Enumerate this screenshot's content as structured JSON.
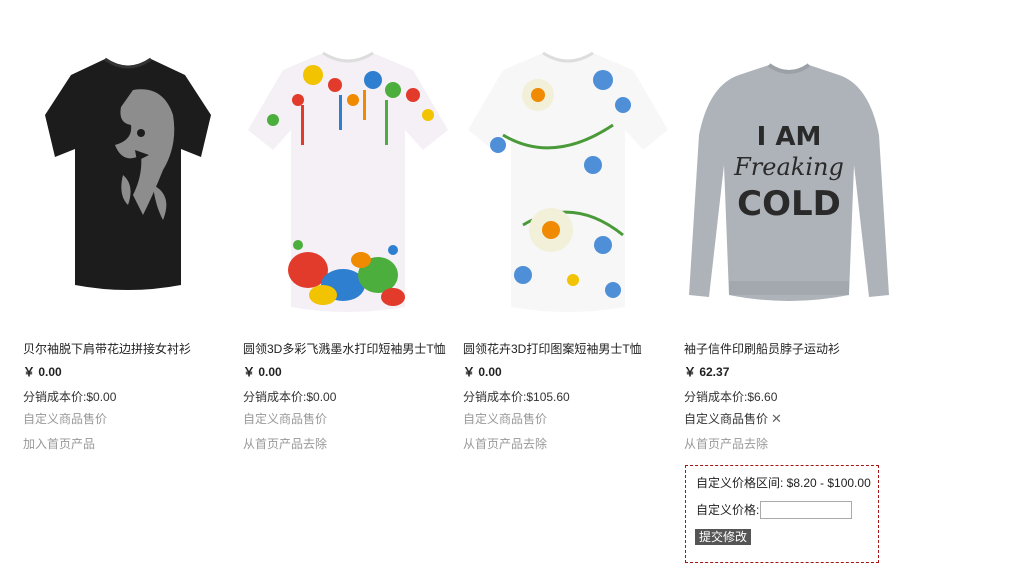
{
  "products": [
    {
      "name": "贝尔袖脱下肩带花边拼接女衬衫",
      "price": "￥ 0.00",
      "cost_label": "分销成本价:",
      "cost": "$0.00",
      "link1": "自定义商品售价",
      "link2": "加入首页产品",
      "image_icon": "black-tshirt-lion-print"
    },
    {
      "name": "圆领3D多彩飞溅墨水打印短袖男士T恤",
      "price": "￥ 0.00",
      "cost_label": "分销成本价:",
      "cost": "$0.00",
      "link1": "自定义商品售价",
      "link2": "从首页产品去除",
      "image_icon": "white-tshirt-paint-splash"
    },
    {
      "name": "圆领花卉3D打印图案短袖男士T恤",
      "price": "￥ 0.00",
      "cost_label": "分销成本价:",
      "cost": "$105.60",
      "link1": "自定义商品售价",
      "link2": "从首页产品去除",
      "image_icon": "floral-tshirt"
    },
    {
      "name": "袖子信件印刷船员脖子运动衫",
      "price": "￥ 62.37",
      "cost_label": "分销成本价:",
      "cost": "$6.60",
      "link1": "自定义商品售价",
      "link2": "从首页产品去除",
      "image_icon": "gray-sweatshirt",
      "print_lines": [
        "I AM",
        "Freaking",
        "COLD"
      ]
    }
  ],
  "price_panel": {
    "range_label": "自定义价格区间: $8.20 - $100.00",
    "price_label": "自定义价格:",
    "price_value": "",
    "submit_label": "提交修改",
    "close_icon": "close-icon",
    "close_glyph": "✕"
  },
  "colors": {
    "muted_link": "#999999",
    "panel_border": "#a31515",
    "submit_bg": "#555555"
  }
}
